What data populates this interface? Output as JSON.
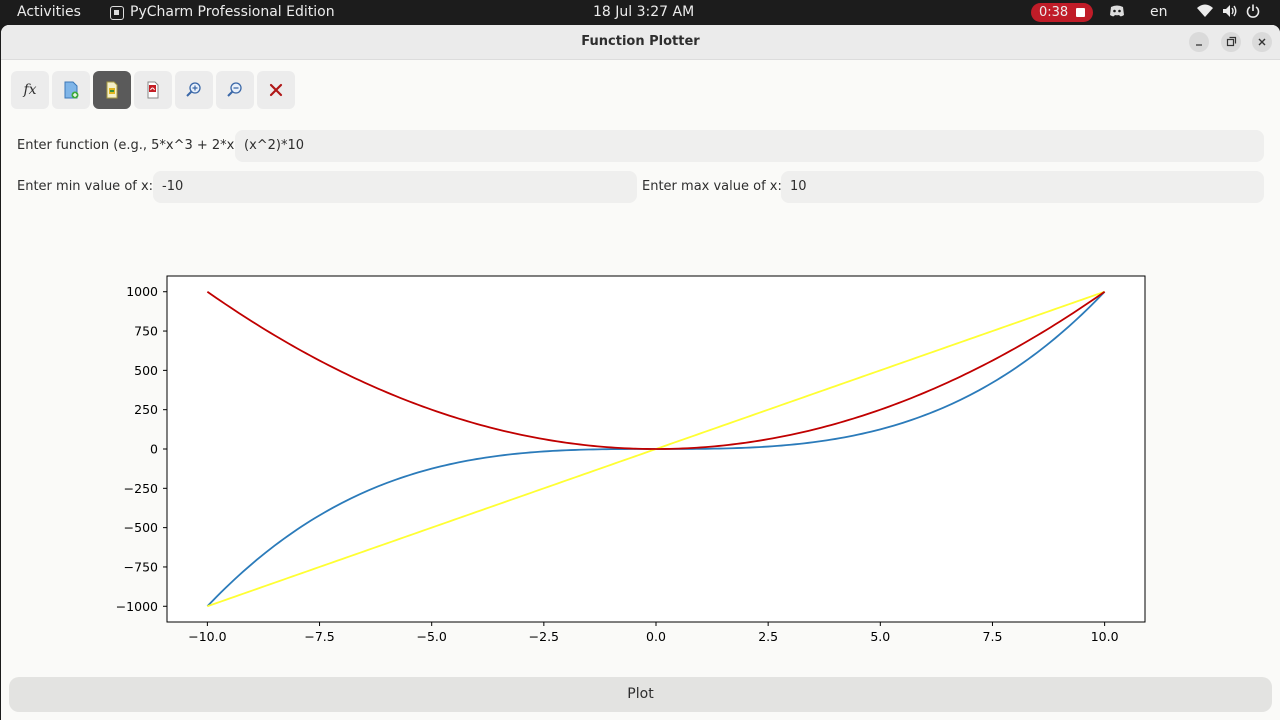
{
  "topbar": {
    "activities": "Activities",
    "app_name": "PyCharm Professional Edition",
    "clock": "18 Jul   3:27 AM",
    "recording_time": "0:38",
    "language": "en"
  },
  "window": {
    "title": "Function Plotter"
  },
  "toolbar": {
    "items": [
      {
        "name": "function-icon",
        "glyph": "fx"
      },
      {
        "name": "new-document-icon"
      },
      {
        "name": "save-image-icon"
      },
      {
        "name": "export-pdf-icon"
      },
      {
        "name": "zoom-in-icon"
      },
      {
        "name": "zoom-out-icon"
      },
      {
        "name": "clear-icon"
      }
    ]
  },
  "form": {
    "function_label": "Enter function (e.g., 5*x^3 + 2*x):",
    "function_value": "(x^2)*10",
    "min_label": "Enter min value of x:",
    "min_value": "-10",
    "max_label": "Enter max value of x:",
    "max_value": "10"
  },
  "plot_button": "Plot",
  "chart_data": {
    "type": "line",
    "xlim": [
      -10.9,
      10.9
    ],
    "ylim": [
      -1100,
      1100
    ],
    "xticks": [
      "−10.0",
      "−7.5",
      "−5.0",
      "−2.5",
      "0.0",
      "2.5",
      "5.0",
      "7.5",
      "10.0"
    ],
    "xtick_values": [
      -10,
      -7.5,
      -5,
      -2.5,
      0,
      2.5,
      5,
      7.5,
      10
    ],
    "yticks": [
      "1000",
      "750",
      "500",
      "250",
      "0",
      "−250",
      "−500",
      "−750",
      "−1000"
    ],
    "ytick_values": [
      1000,
      750,
      500,
      250,
      0,
      -250,
      -500,
      -750,
      -1000
    ],
    "grid": false,
    "series": [
      {
        "expr": "x^3",
        "color": "#2b7bba",
        "x": [
          -10,
          -7.5,
          -5,
          -2.5,
          0,
          2.5,
          5,
          7.5,
          10
        ],
        "values": [
          -1000,
          -421.875,
          -125,
          -15.625,
          0,
          15.625,
          125,
          421.875,
          1000
        ]
      },
      {
        "expr": "100*x",
        "color": "#ffff33",
        "x": [
          -10,
          10
        ],
        "values": [
          -1000,
          1000
        ]
      },
      {
        "expr": "(x^2)*10",
        "color": "#c00000",
        "x": [
          -10,
          -7.5,
          -5,
          -2.5,
          0,
          2.5,
          5,
          7.5,
          10
        ],
        "values": [
          1000,
          562.5,
          250,
          62.5,
          0,
          62.5,
          250,
          562.5,
          1000
        ]
      }
    ]
  }
}
